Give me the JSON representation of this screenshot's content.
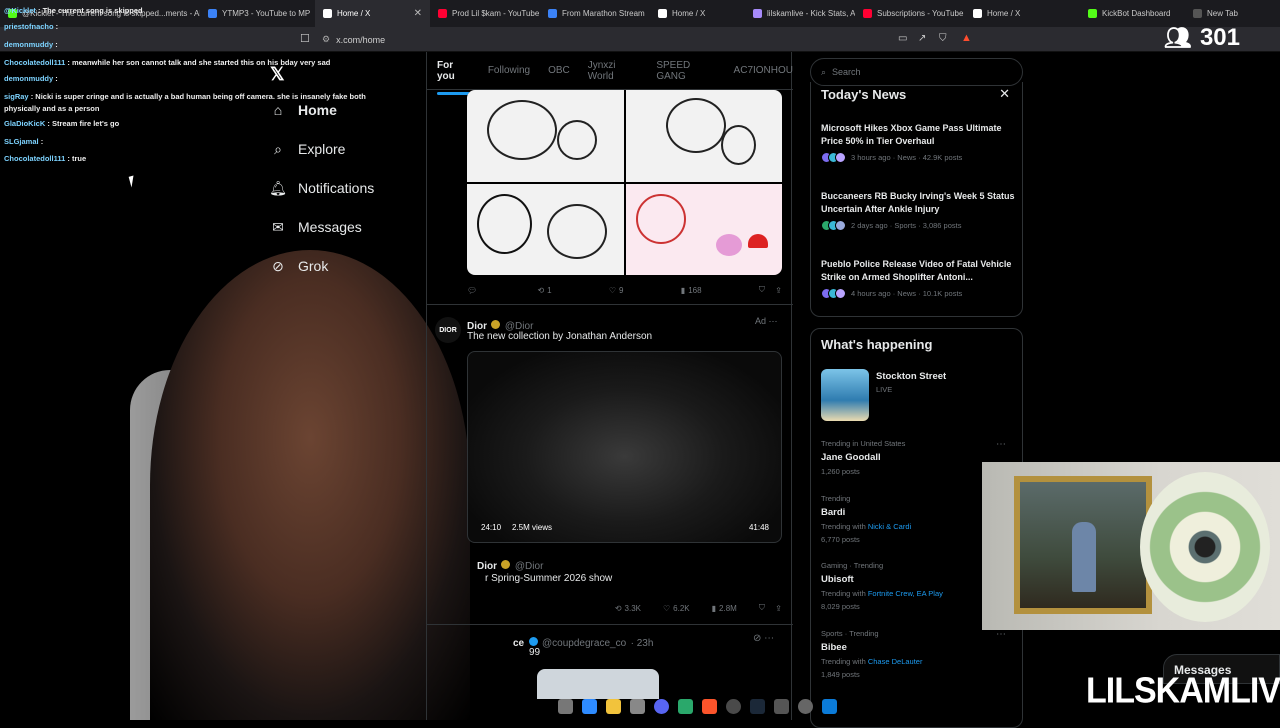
{
  "browser": {
    "tabs": [
      {
        "label": "@Kicklet - The current song is skipped...ments - Ab",
        "color": "#53fc18"
      },
      {
        "label": "YTMP3 - YouTube to MP",
        "color": "#3b82f6"
      },
      {
        "label": "Home / X",
        "color": "#ffffff",
        "active": true
      },
      {
        "label": "Prod Lil $kam - YouTube",
        "color": "#ff0033"
      },
      {
        "label": "From Marathon Stream",
        "color": "#3b82f6"
      },
      {
        "label": "Home / X",
        "color": "#ffffff"
      },
      {
        "label": "lilskamlive - Kick Stats, A",
        "color": "#a78bfa"
      },
      {
        "label": "Subscriptions - YouTube",
        "color": "#ff0033"
      },
      {
        "label": "Home / X",
        "color": "#ffffff"
      },
      {
        "label": "KickBot Dashboard",
        "color": "#53fc18"
      },
      {
        "label": "New Tab",
        "color": "#555555"
      }
    ],
    "url": "x.com/home"
  },
  "chat": [
    {
      "user": "@Kicklet",
      "msg": "The current song is skipped"
    },
    {
      "user": "priestofnacho",
      "msg": ""
    },
    {
      "user": "demonmuddy",
      "msg": ""
    },
    {
      "user": "Chocolatedoll111",
      "msg": "meanwhile her son cannot talk and she started this on his bday very sad"
    },
    {
      "user": "demonmuddy",
      "msg": ""
    },
    {
      "user": "sigRay",
      "msg": "Nicki is super cringe and is actually a bad human being off camera. she is insanely fake both"
    },
    {
      "user": "",
      "msg": "physically and as a person"
    },
    {
      "user": "GlaDioKicK",
      "msg": "Stream fire let's go"
    },
    {
      "user": "SLGjamal",
      "msg": ""
    },
    {
      "user": "Chocolatedoll111",
      "msg": "true"
    }
  ],
  "nav": {
    "items": [
      {
        "label": "Home",
        "icon": "home-icon"
      },
      {
        "label": "Explore",
        "icon": "search-icon"
      },
      {
        "label": "Notifications",
        "icon": "bell-icon"
      },
      {
        "label": "Messages",
        "icon": "mail-icon"
      },
      {
        "label": "Grok",
        "icon": "grok-icon"
      }
    ]
  },
  "feed": {
    "tabs": [
      "For you",
      "Following",
      "OBC",
      "Jynxzi World",
      "SPEED GANG",
      "AC7IONHOU"
    ],
    "post1": {
      "replies": "",
      "reposts": "1",
      "likes": "9",
      "views": "168"
    },
    "post2": {
      "name": "Dior",
      "handle": "@Dior",
      "ad": "Ad",
      "text": "The new collection by Jonathan Anderson",
      "video_left": "24:10",
      "video_views": "2.5M views",
      "video_right": "41:48",
      "quote_name": "Dior",
      "quote_handle": "@Dior",
      "quote_text": "r Spring-Summer 2026 show",
      "reposts": "3.3K",
      "likes": "6.2K",
      "views": "2.8M"
    },
    "post3": {
      "handle": "@coupdegrace_co",
      "time": "23h",
      "name_frag": "ce",
      "text_frag": "99"
    }
  },
  "right": {
    "search_placeholder": "Search",
    "news_title": "Today's News",
    "news": [
      {
        "headline": "Microsoft Hikes Xbox Game Pass Ultimate Price 50% in Tier Overhaul",
        "meta": "3 hours ago · News · 42.9K posts"
      },
      {
        "headline": "Buccaneers RB Bucky Irving's Week 5 Status Uncertain After Ankle Injury",
        "meta": "2 days ago · Sports · 3,086 posts"
      },
      {
        "headline": "Pueblo Police Release Video of Fatal Vehicle Strike on Armed Shoplifter Antoni...",
        "meta": "4 hours ago · News · 10.1K posts"
      }
    ],
    "happening_title": "What's happening",
    "live": {
      "title": "Stockton Street",
      "status": "LIVE"
    },
    "trends": [
      {
        "context": "Trending in United States",
        "topic": "Jane Goodall",
        "with": "",
        "with_links": "",
        "posts": "1,260 posts"
      },
      {
        "context": "Trending",
        "topic": "Bardi",
        "with": "Trending with",
        "with_links": "Nicki & Cardi",
        "posts": "6,770 posts"
      },
      {
        "context": "Gaming · Trending",
        "topic": "Ubisoft",
        "with": "Trending with",
        "with_links": "Fortnite Crew, EA Play",
        "posts": "8,029 posts"
      },
      {
        "context": "Sports · Trending",
        "topic": "Bibee",
        "with": "Trending with",
        "with_links": "Chase DeLauter",
        "posts": "1,849 posts"
      }
    ]
  },
  "stream": {
    "viewer_count": "301",
    "brand": "LILSKAMLIVE",
    "messages_label": "Messages"
  }
}
